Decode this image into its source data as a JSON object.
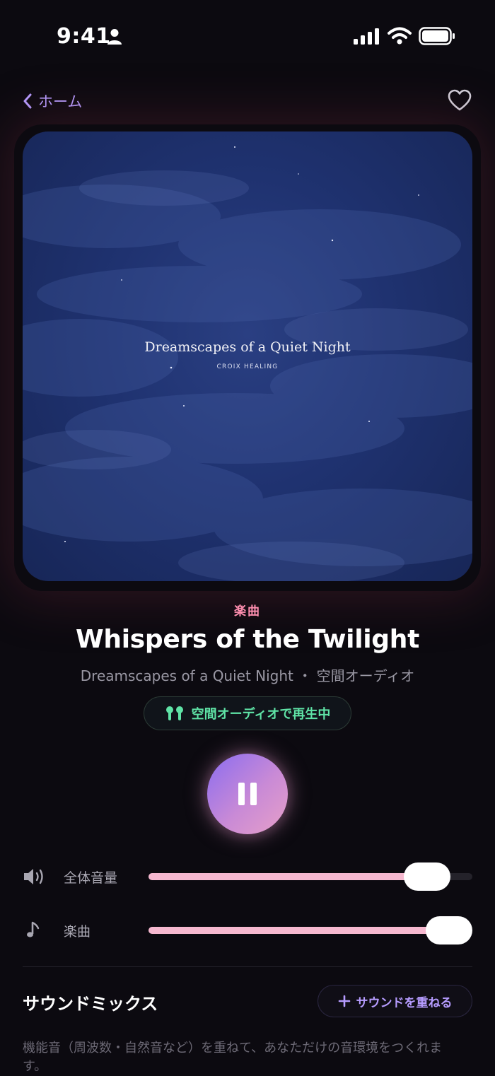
{
  "status_bar": {
    "time": "9:41"
  },
  "nav": {
    "back_label": "ホーム"
  },
  "artwork": {
    "title": "Dreamscapes of a Quiet Night",
    "subtitle": "CROIX HEALING"
  },
  "track": {
    "category": "楽曲",
    "title": "Whispers of the Twilight",
    "meta": "Dreamscapes of a Quiet Night ・ 空間オーディオ",
    "spatial_label": "空間オーディオで再生中"
  },
  "volume": {
    "master_label": "全体音量",
    "master_level": 0.86,
    "music_label": "楽曲",
    "music_level": 1.0
  },
  "sound_mix": {
    "title": "サウンドミックス",
    "add_label": "サウンドを重ねる",
    "description": "機能音（周波数・自然音など）を重ねて、あなただけの音環境をつくれます。"
  },
  "colors": {
    "accent": "#b69cff",
    "pink": "#ff8fb0",
    "green": "#5fe3a6",
    "slider": "#f6b8cf"
  }
}
